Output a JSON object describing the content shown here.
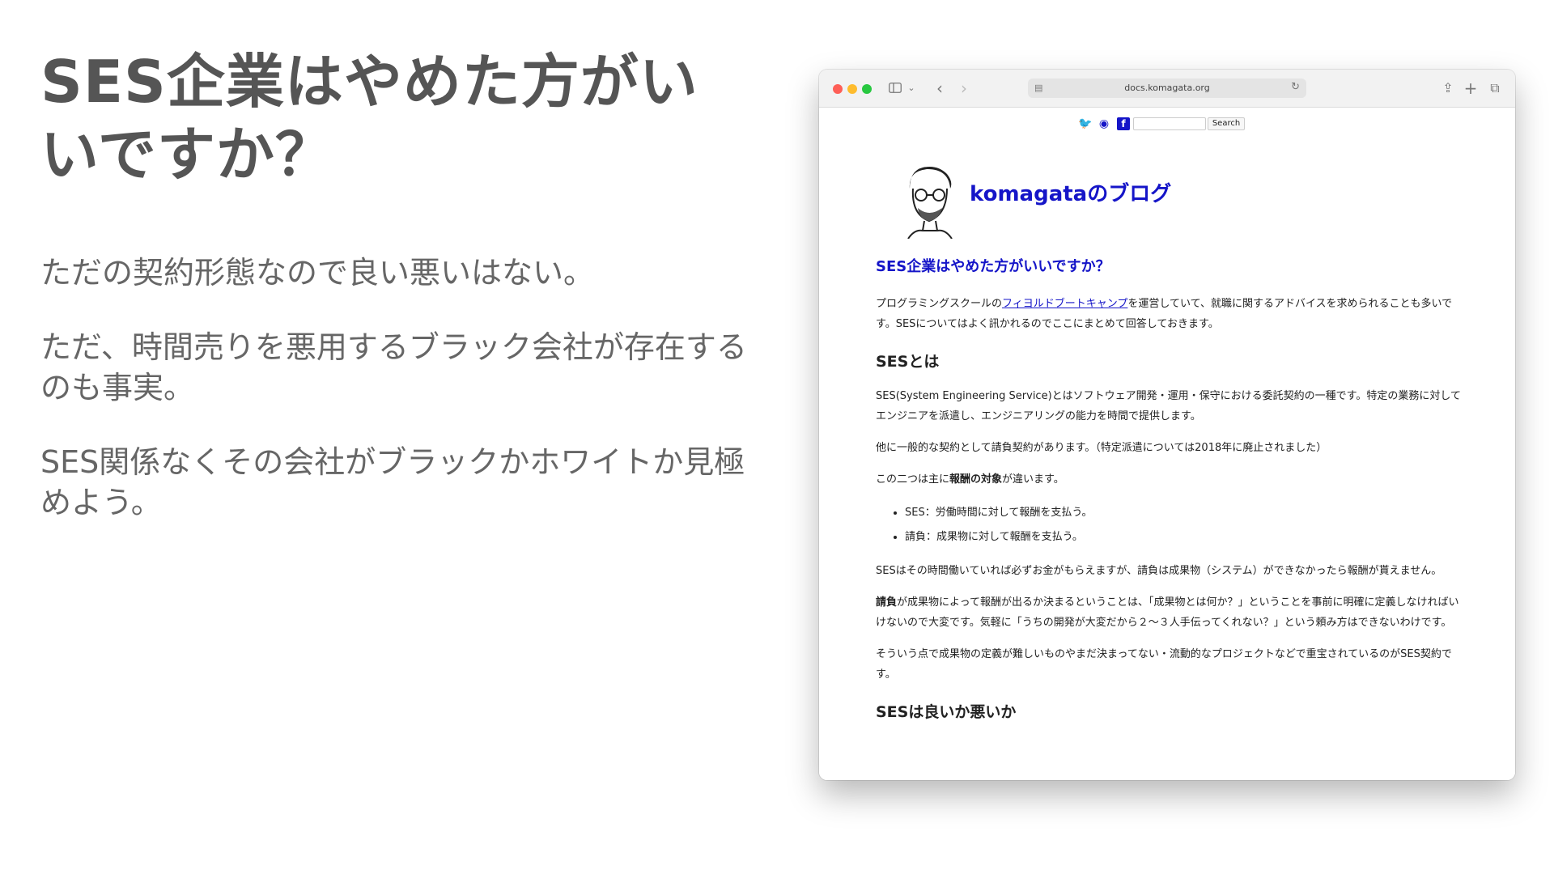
{
  "slide": {
    "title": "SES企業はやめた方がいいですか？",
    "paragraphs": [
      "ただの契約形態なので良い悪いはない。",
      "ただ、時間売りを悪用するブラック会社が存在するのも事実。",
      "SES関係なくその会社がブラックかホワイトか見極めよう。"
    ]
  },
  "browser": {
    "url": "docs.komagata.org",
    "icons": [
      "sidebar-icon",
      "chevron-down-icon",
      "back-icon",
      "forward-icon",
      "page-icon",
      "reload-icon",
      "share-icon",
      "new-tab-icon",
      "tabs-overview-icon"
    ],
    "colors": {
      "red": "#fe5f57",
      "yellow": "#febc2e",
      "green": "#28c840"
    }
  },
  "page": {
    "search_button": "Search",
    "social_icons": [
      "twitter-icon",
      "github-icon",
      "facebook-icon"
    ],
    "blog_title": "komagataのブログ",
    "article_title": "SES企業はやめた方がいいですか？",
    "intro_before": "プログラミングスクールの",
    "intro_link": "フィヨルドブートキャンプ",
    "intro_after": "を運営していて、就職に関するアドバイスを求められることも多いです。SESについてはよく訊かれるのでここにまとめて回答しておきます。",
    "h_ses": "SESとは",
    "p_ses_def": "SES(System Engineering Service)とはソフトウェア開発・運用・保守における委託契約の一種です。特定の業務に対してエンジニアを派遣し、エンジニアリングの能力を時間で提供します。",
    "p_other": "他に一般的な契約として請負契約があります。（特定派遣については2018年に廃止されました）",
    "p_diff_before": "この二つは主に",
    "p_diff_bold": "報酬の対象",
    "p_diff_after": "が違います。",
    "list": [
      "SES：労働時間に対して報酬を支払う。",
      "請負：成果物に対して報酬を支払う。"
    ],
    "p_ses_pay": "SESはその時間働いていれば必ずお金がもらえますが、請負は成果物（システム）ができなかったら報酬が貰えません。",
    "p_ukeoi_bold": "請負",
    "p_ukeoi_after": "が成果物によって報酬が出るか決まるということは、「成果物とは何か？」ということを事前に明確に定義しなければいけないので大変です。気軽に「うちの開発が大変だから２〜３人手伝ってくれない？」という頼み方はできないわけです。",
    "p_point": "そういう点で成果物の定義が難しいものやまだ決まってない・流動的なプロジェクトなどで重宝されているのがSES契約です。",
    "h_good_bad": "SESは良いか悪いか",
    "link_color": "#1515c8"
  }
}
